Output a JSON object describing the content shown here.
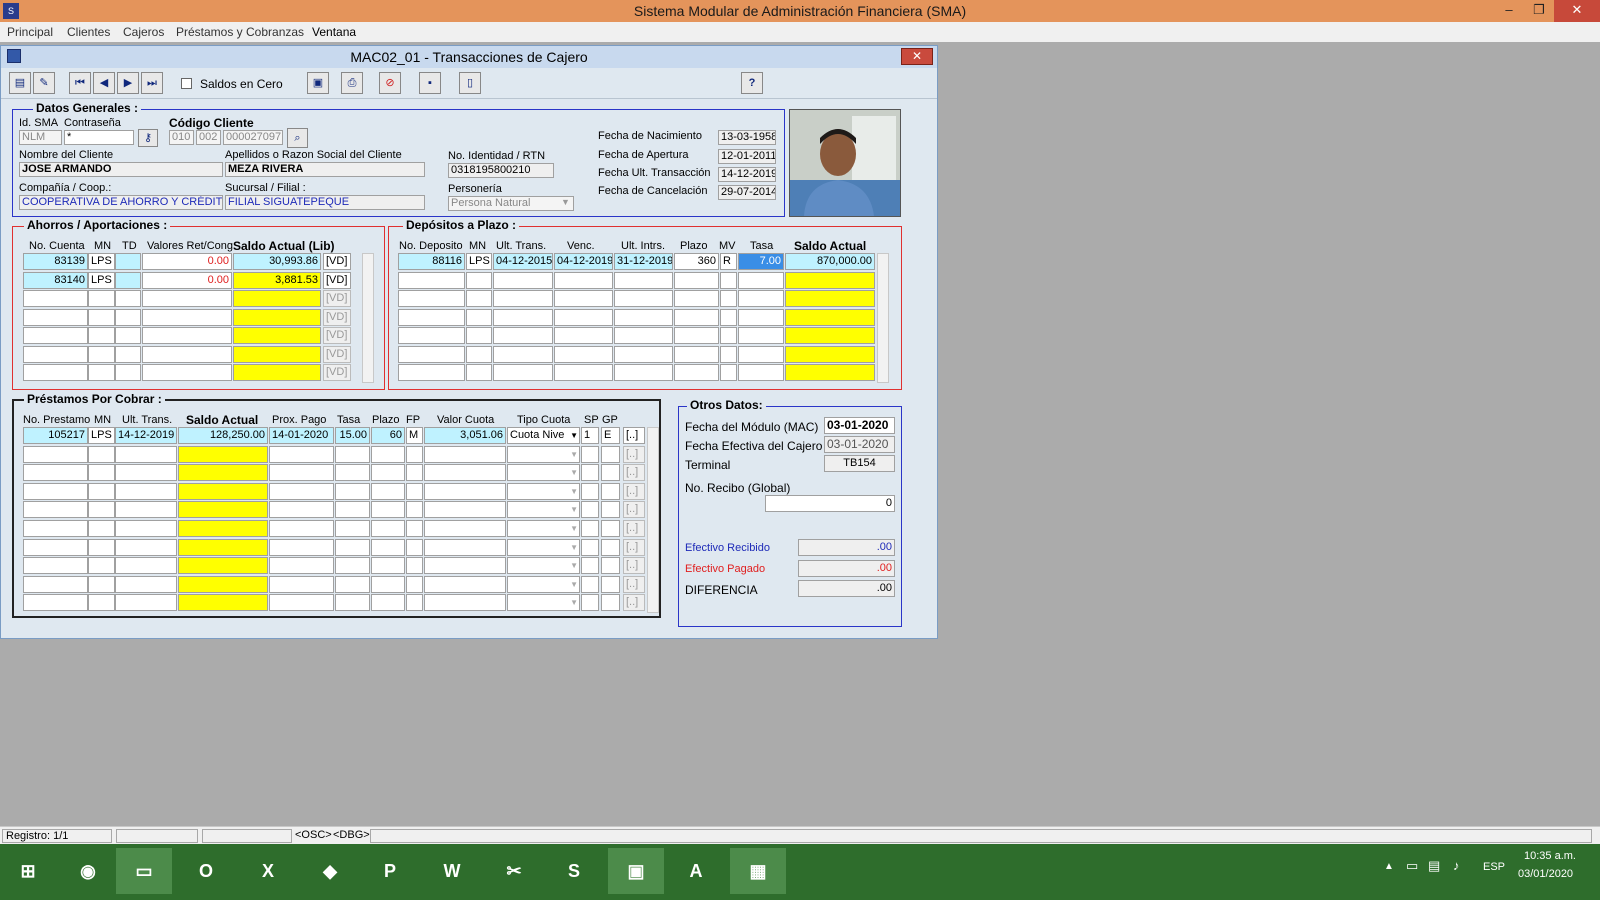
{
  "app": {
    "title": "Sistema Modular de Administración Financiera (SMA)",
    "window_controls": {
      "minimize": "–",
      "maximize": "❐",
      "close": "✕"
    }
  },
  "menu": [
    "Principal",
    "Clientes",
    "Cajeros",
    "Préstamos y Cobranzas",
    "Ventana"
  ],
  "window": {
    "title": "MAC02_01 - Transacciones de Cajero",
    "close": "✕"
  },
  "toolbar": {
    "saldos_cero": "Saldos en Cero",
    "help": "?"
  },
  "datos": {
    "legend": "Datos Generales :",
    "id_sma_label": "Id. SMA",
    "id_sma": "NLM",
    "contrasena_label": "Contraseña",
    "contrasena": "*",
    "codigo_label": "Código Cliente",
    "cod1": "010",
    "cod2": "002",
    "cod3": "000027097",
    "nombre_label": "Nombre del Cliente",
    "nombre": "JOSE ARMANDO",
    "apellidos_label": "Apellidos o Razon Social del Cliente",
    "apellidos": "MEZA RIVERA",
    "compania_label": "Compañía / Coop.:",
    "compania": "COOPERATIVA DE AHORRO Y CRÉDITO",
    "sucursal_label": "Sucursal / Filial :",
    "sucursal": "FILIAL SIGUATEPEQUE",
    "identidad_label": "No. Identidad / RTN",
    "identidad": "0318195800210",
    "personeria_label": "Personería",
    "personeria": "Persona Natural",
    "nac_label": "Fecha de Nacimiento",
    "nac": "13-03-1958",
    "ape_label": "Fecha de  Apertura",
    "ape": "12-01-2011",
    "ult_label": "Fecha Ult. Transacción",
    "ult": "14-12-2019",
    "can_label": "Fecha de Cancelación",
    "can": "29-07-2014"
  },
  "ahorros": {
    "legend": "Ahorros / Aportaciones :",
    "headers": [
      "No. Cuenta",
      "MN",
      "TD",
      "Valores Ret/Cong",
      "Saldo Actual (Lib)"
    ],
    "rows": [
      {
        "cuenta": "83139",
        "mn": "LPS",
        "td": "",
        "valores": "0.00",
        "saldo": "30,993.86",
        "vd": "[VD]"
      },
      {
        "cuenta": "83140",
        "mn": "LPS",
        "td": "",
        "valores": "0.00",
        "saldo": "3,881.53",
        "vd": "[VD]"
      }
    ],
    "empty_vd": "[VD]"
  },
  "depositos": {
    "legend": "Depósitos a Plazo :",
    "headers": [
      "No. Deposito",
      "MN",
      "Ult. Trans.",
      "Venc.",
      "Ult. Intrs.",
      "Plazo",
      "MV",
      "Tasa",
      "Saldo Actual"
    ],
    "row": {
      "num": "88116",
      "mn": "LPS",
      "ult": "04-12-2015",
      "venc": "04-12-2019",
      "intrs": "31-12-2019",
      "plazo": "360",
      "mv": "R",
      "tasa": "7.00",
      "saldo": "870,000.00"
    }
  },
  "prestamos": {
    "legend": "Préstamos Por Cobrar :",
    "headers": [
      "No. Prestamo",
      "MN",
      "Ult. Trans.",
      "Saldo Actual",
      "Prox. Pago",
      "Tasa",
      "Plazo",
      "FP",
      "Valor Cuota",
      "Tipo Cuota",
      "SP",
      "GP"
    ],
    "row": {
      "num": "105217",
      "mn": "LPS",
      "ult": "14-12-2019",
      "saldo": "128,250.00",
      "prox": "14-01-2020",
      "tasa": "15.00",
      "plazo": "60",
      "fp": "M",
      "cuota": "3,051.06",
      "tipo": "Cuota Nive",
      "sp": "1",
      "gp": "E",
      "btn": "[..]"
    },
    "empty_btn": "[..]"
  },
  "otros": {
    "legend": "Otros Datos:",
    "fecha_mod_label": "Fecha del Módulo (MAC)",
    "fecha_mod": "03-01-2020",
    "fecha_caj_label": "Fecha Efectiva del Cajero",
    "fecha_caj": "03-01-2020",
    "terminal_label": "Terminal",
    "terminal": "TB154",
    "recibo_label": "No. Recibo (Global)",
    "recibo": "0",
    "efec_rec_label": "Efectivo Recibido",
    "efec_rec": ".00",
    "efec_pag_label": "Efectivo Pagado",
    "efec_pag": ".00",
    "dif_label": "DIFERENCIA",
    "dif": ".00"
  },
  "status": {
    "registro": "Registro: 1/1",
    "osc": "<OSC>",
    "dbg": "<DBG>"
  },
  "taskbar": {
    "lang": "ESP",
    "time": "10:35 a.m.",
    "date": "03/01/2020",
    "apps": [
      "windows-start",
      "chrome",
      "file-explorer",
      "outlook",
      "excel",
      "onenote",
      "powerpoint",
      "word",
      "snipping",
      "skype",
      "sma-app",
      "acrobat",
      "planner"
    ]
  },
  "colors": {
    "title": "#e4945b",
    "yellow": "#ffff00",
    "cyan": "#bff2ff",
    "red_frame": "#e03030",
    "blue_frame": "#2a35c8"
  }
}
